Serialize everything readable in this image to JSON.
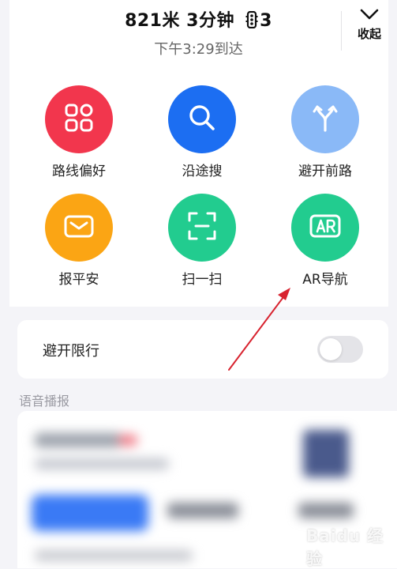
{
  "route": {
    "distance_time": "821米 3分钟",
    "traffic_lights": "3",
    "arrival": "下午3:29到达"
  },
  "collapse": {
    "label": "收起"
  },
  "options": [
    {
      "label": "路线偏好",
      "icon": "grid-icon",
      "color": "#f2364d"
    },
    {
      "label": "沿途搜",
      "icon": "search-icon",
      "color": "#1c6ef2"
    },
    {
      "label": "避开前路",
      "icon": "fork-arrow-icon",
      "color": "#8ab9f7"
    },
    {
      "label": "报平安",
      "icon": "envelope-icon",
      "color": "#fba514"
    },
    {
      "label": "扫一扫",
      "icon": "scan-icon",
      "color": "#22cc8f"
    },
    {
      "label": "AR导航",
      "icon": "ar-icon",
      "color": "#22cc8f"
    }
  ],
  "restriction": {
    "label": "避开限行",
    "enabled": false
  },
  "voice": {
    "section_title": "语音播报"
  },
  "watermark": "Baidu 经验"
}
